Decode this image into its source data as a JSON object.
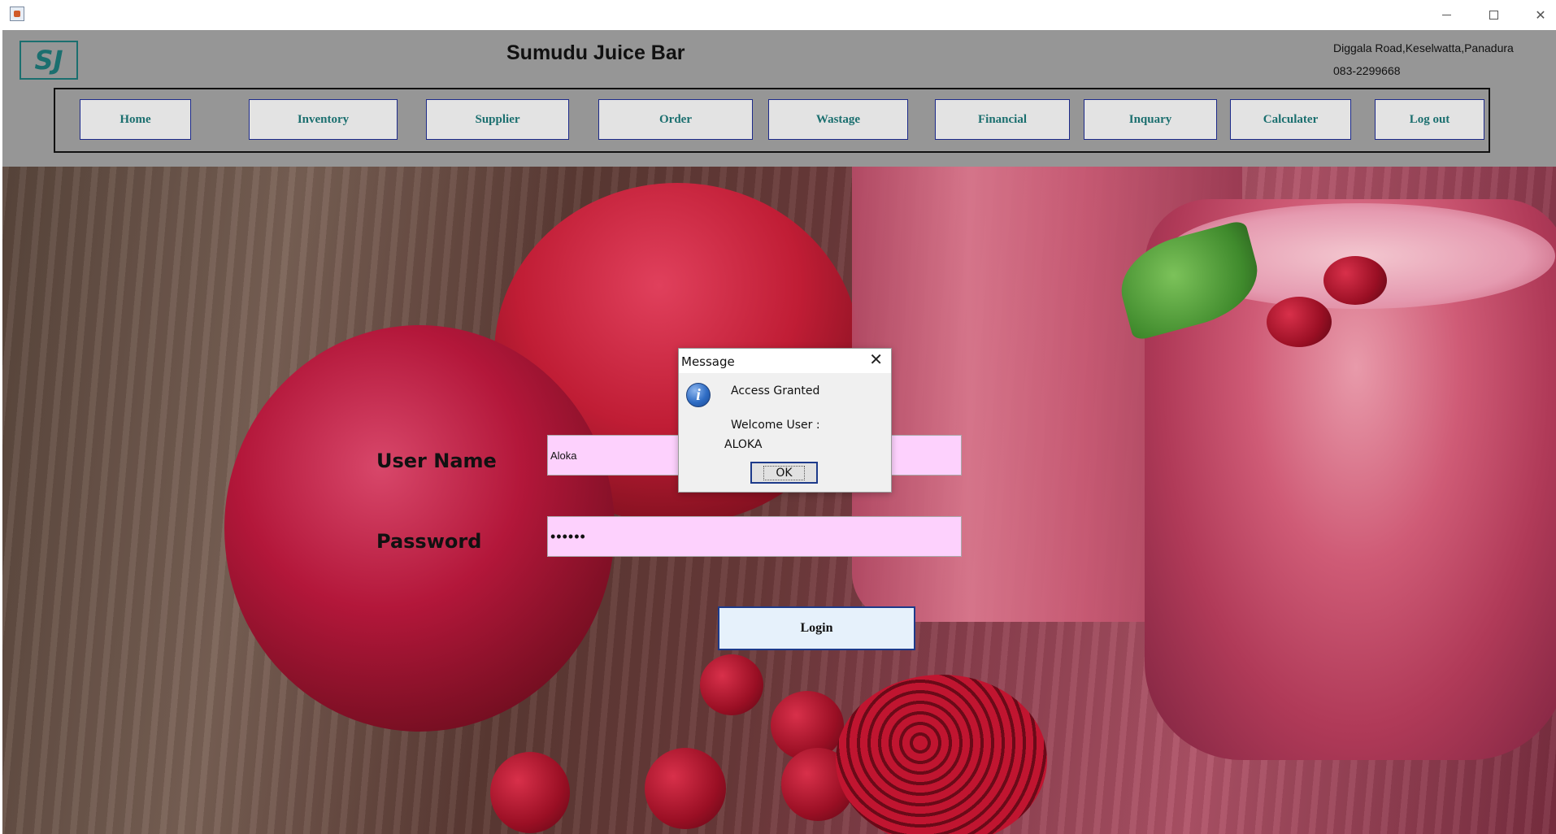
{
  "window": {
    "icon": "java-app-icon",
    "controls": [
      "minimize-icon",
      "maximize-icon",
      "close-icon"
    ]
  },
  "header": {
    "logo_text": "SJ",
    "title": "Sumudu Juice Bar",
    "address": "Diggala Road,Keselwatta,Panadura",
    "phone": "083-2299668"
  },
  "nav": {
    "items": [
      {
        "label": "Home"
      },
      {
        "label": "Inventory"
      },
      {
        "label": "Supplier"
      },
      {
        "label": "Order"
      },
      {
        "label": "Wastage"
      },
      {
        "label": "Financial"
      },
      {
        "label": "Inquary"
      },
      {
        "label": "Calculater"
      },
      {
        "label": "Log out"
      }
    ]
  },
  "login": {
    "username_label": "User Name",
    "username_value": "Aloka",
    "password_label": "Password",
    "password_value": "••••••",
    "login_button": "Login"
  },
  "dialog": {
    "title": "Message",
    "close_symbol": "✕",
    "icon": "information-icon",
    "line1": "Access Granted",
    "line2": "Welcome User :",
    "line3": "ALOKA",
    "ok_button": "OK"
  },
  "colors": {
    "header_bg": "#969696",
    "nav_text": "#1b6f6f",
    "field_bg": "#fdd1fd",
    "button_border": "#1d3a8a"
  }
}
